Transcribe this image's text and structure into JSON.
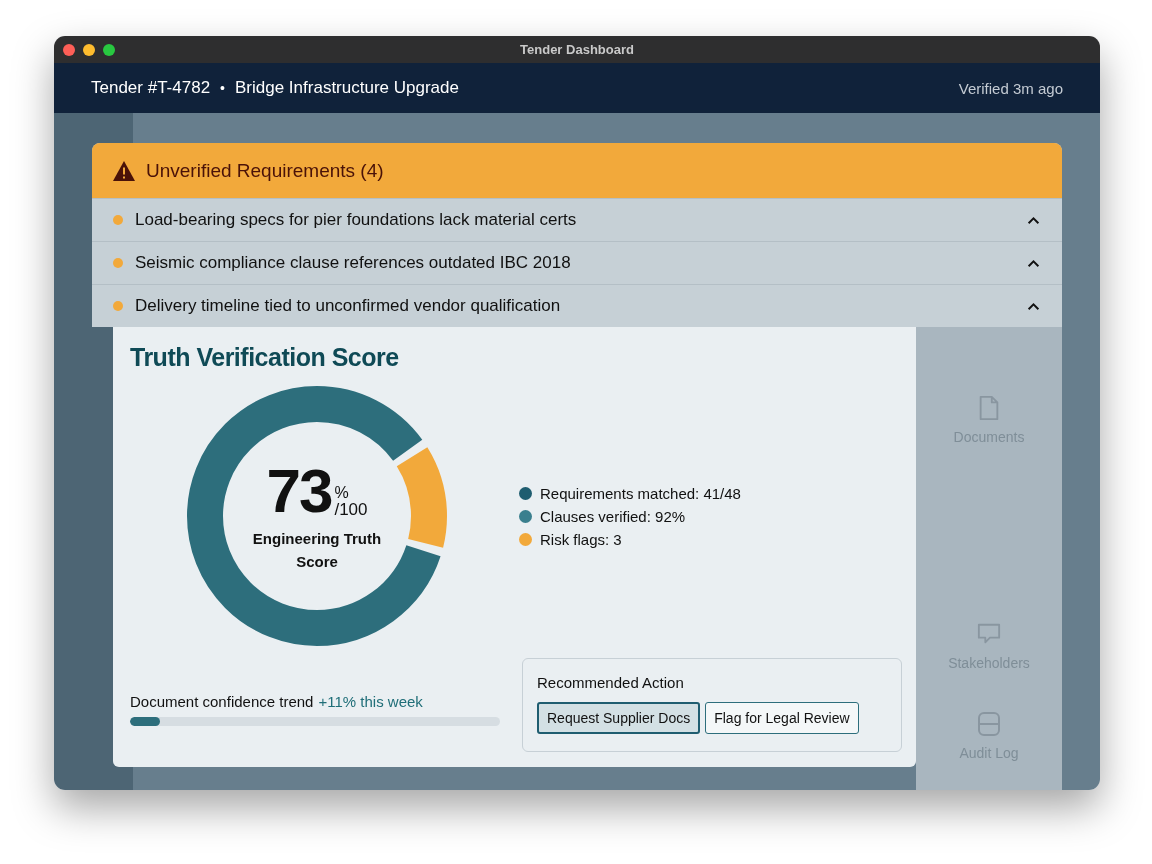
{
  "window": {
    "title": "Tender Dashboard"
  },
  "header": {
    "tender_id": "Tender #T-4782",
    "separator": "•",
    "project": "Bridge Infrastructure Upgrade",
    "status": "Verified 3m ago"
  },
  "alert": {
    "title": "Unverified Requirements (4)",
    "items": [
      {
        "text": "Load-bearing specs for pier foundations lack material certs"
      },
      {
        "text": "Seismic compliance clause references outdated IBC 2018"
      },
      {
        "text": "Delivery timeline tied to unconfirmed vendor qualification"
      }
    ]
  },
  "score_card": {
    "title": "Truth Verification Score",
    "score": {
      "value": "73",
      "unit": "%",
      "scale": "/100",
      "label": "Engineering Truth Score"
    },
    "legend": [
      {
        "label": "Requirements matched: 41/48",
        "color": "#1f5d70"
      },
      {
        "label": "Clauses verified: 92%",
        "color": "#3a7f8e"
      },
      {
        "label": "Risk flags: 3",
        "color": "#f2a93b"
      }
    ],
    "trend": {
      "label": "Document confidence trend",
      "change": "+11% this week",
      "level": 0.08
    },
    "recommended": {
      "title": "Recommended Action",
      "buttons": [
        {
          "label": "Request Supplier Docs",
          "selected": true
        },
        {
          "label": "Flag for Legal Review",
          "selected": false
        }
      ]
    }
  },
  "side_nav": [
    {
      "label": "Documents",
      "kind": "document"
    },
    {
      "label": "Stakeholders",
      "kind": "chat"
    },
    {
      "label": "Audit Log",
      "kind": "database"
    }
  ]
}
